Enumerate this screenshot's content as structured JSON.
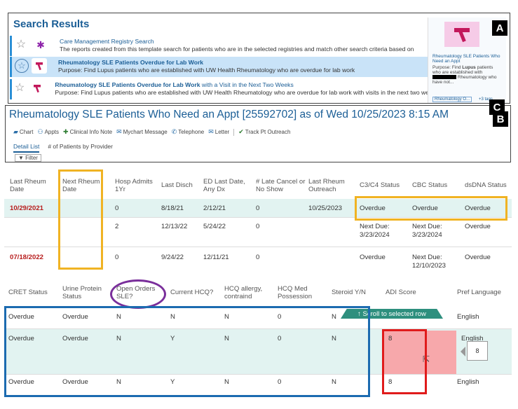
{
  "panel_tags": {
    "a": "A",
    "b": "B",
    "c": "C"
  },
  "search": {
    "title": "Search Results",
    "rows": [
      {
        "name": "Care Management Registry Search",
        "desc": "The reports created from this template search for patients who are in the selected registries and match other search criteria based on",
        "icon": "gear-icon"
      },
      {
        "name": "Rheumatology SLE Patients Overdue for Lab Work",
        "desc": "Purpose: Find Lupus patients who are established with UW Health Rheumatology who are overdue for lab work",
        "icon": "hammer-icon"
      },
      {
        "name_bold": "Rheumatology SLE Patients Overdue for Lab Work",
        "name_rest": " with a Visit in the Next Two Weeks",
        "desc": "Purpose: Find Lupus patients who are established with UW Health Rheumatology who are overdue for lab work with visits in the next two we",
        "icon": "hammer-icon"
      }
    ],
    "preview": {
      "name": "Rheumatology SLE Patients Who Need an Appt",
      "purpose_1": "Purpose: Find ",
      "purpose_bold": "Lupus",
      "purpose_2": " patients who are established with",
      "purpose_3": "Rheumatology who have not...",
      "chip": "Rheumatology O...",
      "more": "+3 tags"
    }
  },
  "report": {
    "title": "Rheumatology SLE Patients Who Need an Appt [25592702] as of Wed 10/25/2023  8:15 AM",
    "toolbar": [
      "Chart",
      "Appts",
      "Clinical Info Note",
      "Mychart Message",
      "Telephone",
      "Letter",
      "Track Pt Outreach"
    ],
    "tabs": [
      "Detail List",
      "# of Patients by Provider"
    ],
    "filter": "Filter"
  },
  "grid1": {
    "headers": [
      "Last Rheum Date",
      "Next Rheum Date",
      "Hosp Admits 1Yr",
      "Last Disch",
      "ED Last Date, Any Dx",
      "# Late Cancel or No Show",
      "Last Rheum Outreach",
      "C3/C4 Status",
      "CBC Status",
      "dsDNA Status"
    ],
    "rows": [
      [
        "10/29/2021",
        "",
        "0",
        "8/18/21",
        "2/12/21",
        "0",
        "10/25/2023",
        "Overdue",
        "Overdue",
        "Overdue"
      ],
      [
        "",
        "",
        "2",
        "12/13/22",
        "5/24/22",
        "0",
        "",
        "Next Due: 3/23/2024",
        "Next Due: 3/23/2024",
        "Overdue"
      ],
      [
        "07/18/2022",
        "",
        "0",
        "9/24/22",
        "12/11/21",
        "0",
        "",
        "Overdue",
        "Next Due: 12/10/2023",
        "Overdue"
      ]
    ]
  },
  "grid2": {
    "headers": [
      "CRET Status",
      "Urine Protein Status",
      "Open Orders SLE?",
      "Current HCQ?",
      "HCQ allergy, contraind",
      "HCQ Med Possession",
      "Steroid Y/N",
      "ADI Score",
      "Pref Language"
    ],
    "rows": [
      [
        "Overdue",
        "Overdue",
        "N",
        "N",
        "N",
        "0",
        "N",
        "",
        "English"
      ],
      [
        "Overdue",
        "Overdue",
        "N",
        "Y",
        "N",
        "0",
        "N",
        "8",
        "English"
      ],
      [
        "Overdue",
        "Overdue",
        "N",
        "Y",
        "N",
        "0",
        "N",
        "8",
        "English"
      ]
    ],
    "scroll_label": "↑ Scroll to selected row",
    "tooltip": "8"
  }
}
